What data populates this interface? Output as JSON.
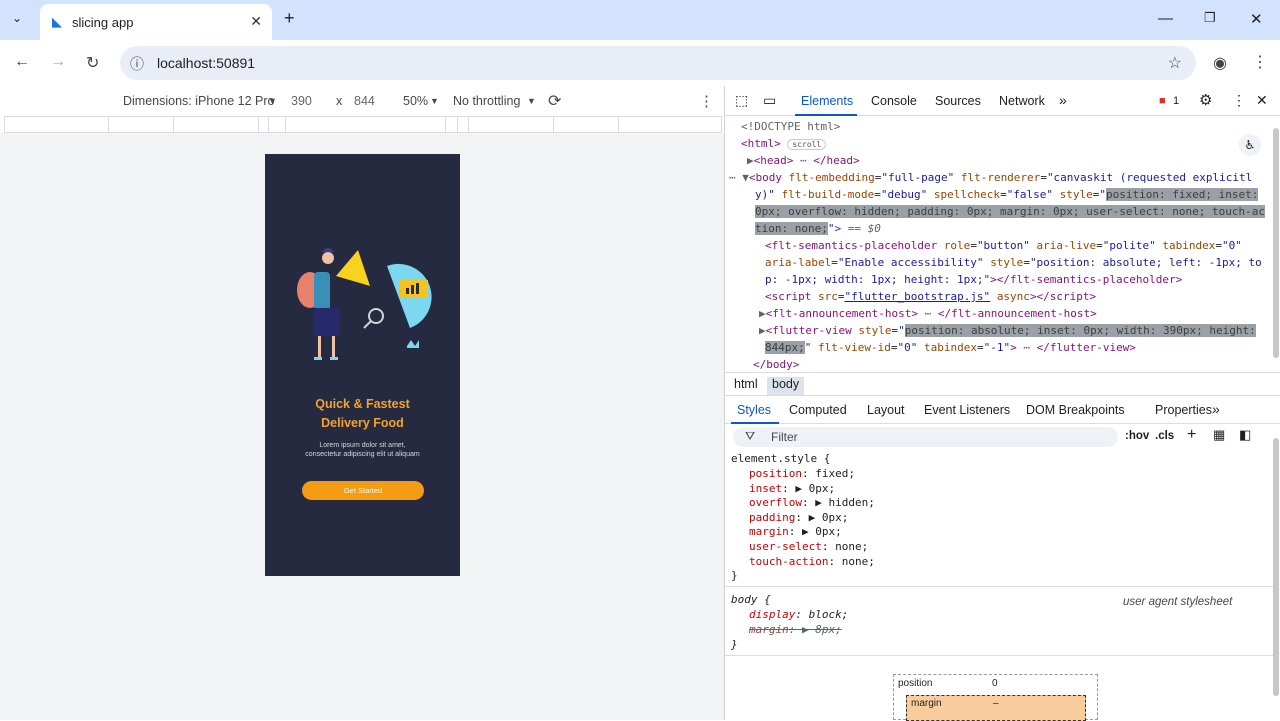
{
  "browser": {
    "tab_title": "slicing app",
    "url": "localhost:50891"
  },
  "device_toolbar": {
    "dimensions": "Dimensions: iPhone 12 Pro",
    "width": "390",
    "times": "x",
    "height": "844",
    "zoom": "50%",
    "throttling": "No throttling"
  },
  "app": {
    "headline_1": "Quick & Fastest",
    "headline_2": "Delivery Food",
    "body_1": "Lorem ipsum dolor sit amet,",
    "body_2": "consectetur adipiscing elit ut aliquam",
    "button": "Get Started"
  },
  "devtools": {
    "tabs": [
      "Elements",
      "Console",
      "Sources",
      "Network"
    ],
    "issues_count": "1",
    "breadcrumbs": [
      "html",
      "body"
    ],
    "style_tabs": [
      "Styles",
      "Computed",
      "Layout",
      "Event Listeners",
      "DOM Breakpoints",
      "Properties"
    ],
    "filter_placeholder": "Filter",
    "hov": ":hov",
    "cls": ".cls",
    "element_style_selector": "element.style {",
    "element_style": [
      {
        "prop": "position",
        "value": "fixed;"
      },
      {
        "prop": "inset",
        "value": "▶ 0px;"
      },
      {
        "prop": "overflow",
        "value": "▶ hidden;"
      },
      {
        "prop": "padding",
        "value": "▶ 0px;"
      },
      {
        "prop": "margin",
        "value": "▶ 0px;"
      },
      {
        "prop": "user-select",
        "value": "none;"
      },
      {
        "prop": "touch-action",
        "value": "none;"
      }
    ],
    "body_selector": "body {",
    "ua_label": "user agent stylesheet",
    "body_rules": [
      {
        "prop": "display",
        "value": "block;"
      },
      {
        "prop": "margin",
        "value": "▶ 8px;"
      }
    ],
    "close_brace": "}",
    "box_position_label": "position",
    "box_position_value": "0",
    "box_margin_label": "margin",
    "box_margin_value": "–"
  }
}
